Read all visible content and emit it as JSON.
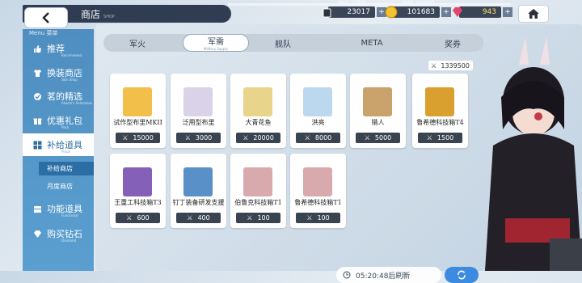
{
  "header": {
    "title": "商店",
    "title_sub": "SHOP",
    "back_label": "‹"
  },
  "resources": [
    {
      "max": "MAX_17950",
      "value": "23017"
    },
    {
      "max": "MAX_109800",
      "value": "101683"
    },
    {
      "max": "",
      "value": "943"
    }
  ],
  "sidebar": {
    "header": "Menu 菜单",
    "items": [
      {
        "label": "推荐",
        "sub": "Recommend"
      },
      {
        "label": "换装商店",
        "sub": "Skin Shop"
      },
      {
        "label": "茗的精选",
        "sub": "Akashi's Selections"
      },
      {
        "label": "优惠礼包",
        "sub": "Pack"
      },
      {
        "label": "补给道具",
        "sub": "Props"
      },
      {
        "label": "功能道具",
        "sub": "Functional"
      },
      {
        "label": "购买钻石",
        "sub": "Diamond"
      }
    ],
    "subitems": [
      "补给商店",
      "月度商店"
    ]
  },
  "tabs": [
    {
      "label": "军火",
      "sub": ""
    },
    {
      "label": "军需",
      "sub": "Military Supply"
    },
    {
      "label": "舰队",
      "sub": ""
    },
    {
      "label": "META",
      "sub": ""
    },
    {
      "label": "奖券",
      "sub": ""
    }
  ],
  "counter": "1339500",
  "cards": [
    {
      "name": "试作型布里MKII",
      "price": "15000",
      "color": "#f2c04a"
    },
    {
      "name": "泛用型布里",
      "price": "3000",
      "color": "#d9d2e8"
    },
    {
      "name": "大青花鱼",
      "price": "20000",
      "color": "#e8d48a"
    },
    {
      "name": "洪亮",
      "price": "8000",
      "color": "#bcd8ee"
    },
    {
      "name": "猎人",
      "price": "5000",
      "color": "#c9a26c"
    },
    {
      "name": "鲁希德科技箱T4",
      "price": "1500",
      "color": "#d9a030"
    },
    {
      "name": "王重工科技箱T3",
      "price": "600",
      "color": "#8560b8"
    },
    {
      "name": "钉丁装备研发支援",
      "price": "400",
      "color": "#5a90c8"
    },
    {
      "name": "伯鲁克科技箱T1",
      "price": "100",
      "color": "#d8a9ad"
    },
    {
      "name": "鲁希德科技箱T1",
      "price": "100",
      "color": "#d8a9ad"
    }
  ],
  "timer": "05:20:48后刷新"
}
